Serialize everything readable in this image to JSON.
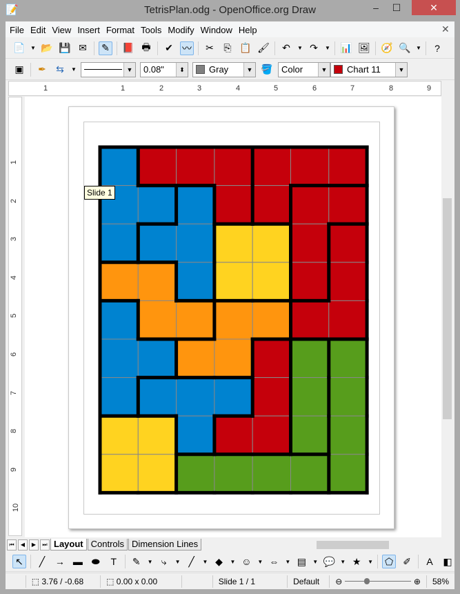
{
  "window": {
    "title": "TetrisPlan.odg - OpenOffice.org Draw",
    "minimize": "–",
    "maximize": "☐",
    "close": "✕"
  },
  "menu": [
    "File",
    "Edit",
    "View",
    "Insert",
    "Format",
    "Tools",
    "Modify",
    "Window",
    "Help"
  ],
  "menu_close": "✕",
  "toolbar_standard": [
    {
      "name": "new-icon",
      "glyph": "📄",
      "dd": true
    },
    {
      "name": "open-icon",
      "glyph": "📂"
    },
    {
      "name": "save-icon",
      "glyph": "💾"
    },
    {
      "name": "email-icon",
      "glyph": "✉"
    },
    {
      "sep": true
    },
    {
      "name": "edit-file-icon",
      "glyph": "✎",
      "active": true
    },
    {
      "sep": true
    },
    {
      "name": "export-pdf-icon",
      "glyph": "📕"
    },
    {
      "name": "print-icon",
      "glyph": "🖶"
    },
    {
      "sep": true
    },
    {
      "name": "spellcheck-icon",
      "glyph": "✔"
    },
    {
      "name": "autospellcheck-icon",
      "glyph": "〰",
      "active": true
    },
    {
      "sep": true
    },
    {
      "name": "cut-icon",
      "glyph": "✂"
    },
    {
      "name": "copy-icon",
      "glyph": "⎘"
    },
    {
      "name": "paste-icon",
      "glyph": "📋"
    },
    {
      "name": "clone-format-icon",
      "glyph": "🖌"
    },
    {
      "sep": true
    },
    {
      "name": "undo-icon",
      "glyph": "↶",
      "dd": true
    },
    {
      "name": "redo-icon",
      "glyph": "↷",
      "dd": true
    },
    {
      "sep": true
    },
    {
      "name": "chart-icon",
      "glyph": "📊"
    },
    {
      "name": "gallery-icon",
      "glyph": "🖼"
    },
    {
      "sep": true
    },
    {
      "name": "navigator-icon",
      "glyph": "🧭"
    },
    {
      "name": "zoom-icon",
      "glyph": "🔍",
      "dd": true
    },
    {
      "sep": true
    },
    {
      "name": "help-icon",
      "glyph": "?"
    }
  ],
  "line_toolbar": {
    "line_width": "0.08\"",
    "line_color": "Gray",
    "line_color_hex": "#808080",
    "area_style": "Color",
    "fill_color": "Chart 11",
    "fill_color_hex": "#c5000b"
  },
  "hruler": [
    "1",
    "1",
    "2",
    "3",
    "4",
    "5",
    "6",
    "7",
    "8",
    "9"
  ],
  "vruler": [
    "1",
    "2",
    "3",
    "4",
    "5",
    "6",
    "7",
    "8",
    "9",
    "10"
  ],
  "tooltip": "Slide 1",
  "tetris": {
    "colors": {
      "B": "#0083d0",
      "R": "#c5000b",
      "Y": "#ffd320",
      "O": "#ff950e",
      "G": "#579d1c"
    },
    "cells": [
      [
        "B",
        "R",
        "R",
        "R",
        "R",
        "R",
        "R"
      ],
      [
        "B",
        "B",
        "B",
        "R",
        "R",
        "R",
        "R"
      ],
      [
        "B",
        "B",
        "B",
        "Y",
        "Y",
        "R",
        "R"
      ],
      [
        "O",
        "O",
        "B",
        "Y",
        "Y",
        "R",
        "R"
      ],
      [
        "B",
        "O",
        "O",
        "O",
        "O",
        "R",
        "R"
      ],
      [
        "B",
        "B",
        "O",
        "O",
        "R",
        "G",
        "G"
      ],
      [
        "B",
        "B",
        "B",
        "B",
        "R",
        "G",
        "G"
      ],
      [
        "Y",
        "Y",
        "B",
        "R",
        "R",
        "G",
        "G"
      ],
      [
        "Y",
        "Y",
        "G",
        "G",
        "G",
        "G",
        "G"
      ]
    ],
    "pieces": [
      "abbbccc",
      "aadbcgg",
      "addeegh",
      "ffdeegh",
      "jffiihh",
      "jjiilmo",
      "jkkklmo",
      "nnkllmo",
      "nnppppo"
    ]
  },
  "tabs": [
    "Layout",
    "Controls",
    "Dimension Lines"
  ],
  "drawing_toolbar": [
    {
      "name": "select-icon",
      "glyph": "↖",
      "active": true
    },
    {
      "sep": true
    },
    {
      "name": "line-icon",
      "glyph": "╱"
    },
    {
      "name": "arrow-line-icon",
      "glyph": "→"
    },
    {
      "name": "rectangle-icon",
      "glyph": "▬"
    },
    {
      "name": "ellipse-icon",
      "glyph": "⬬"
    },
    {
      "name": "text-icon",
      "glyph": "T"
    },
    {
      "sep": true
    },
    {
      "name": "curve-icon",
      "glyph": "✎",
      "dd": true
    },
    {
      "name": "connector-icon",
      "glyph": "⤷",
      "dd": true
    },
    {
      "name": "lines-arrows-icon",
      "glyph": "╱",
      "dd": true
    },
    {
      "name": "basic-shapes-icon",
      "glyph": "◆",
      "dd": true
    },
    {
      "name": "symbol-shapes-icon",
      "glyph": "☺",
      "dd": true
    },
    {
      "name": "block-arrows-icon",
      "glyph": "⇔",
      "dd": true
    },
    {
      "name": "flowchart-icon",
      "glyph": "▤",
      "dd": true
    },
    {
      "name": "callouts-icon",
      "glyph": "💬",
      "dd": true
    },
    {
      "name": "stars-icon",
      "glyph": "★",
      "dd": true
    },
    {
      "sep": true
    },
    {
      "name": "points-icon",
      "glyph": "⬠",
      "active": true
    },
    {
      "name": "glue-points-icon",
      "glyph": "✐"
    },
    {
      "sep": true
    },
    {
      "name": "fontwork-icon",
      "glyph": "A"
    },
    {
      "name": "extrusion-icon",
      "glyph": "◧"
    }
  ],
  "status": {
    "position": "3.76 / -0.68",
    "size": "0.00 x 0.00",
    "slide": "Slide 1 / 1",
    "layout": "Default",
    "zoom_percent": "58%",
    "zoom_level": 58
  }
}
